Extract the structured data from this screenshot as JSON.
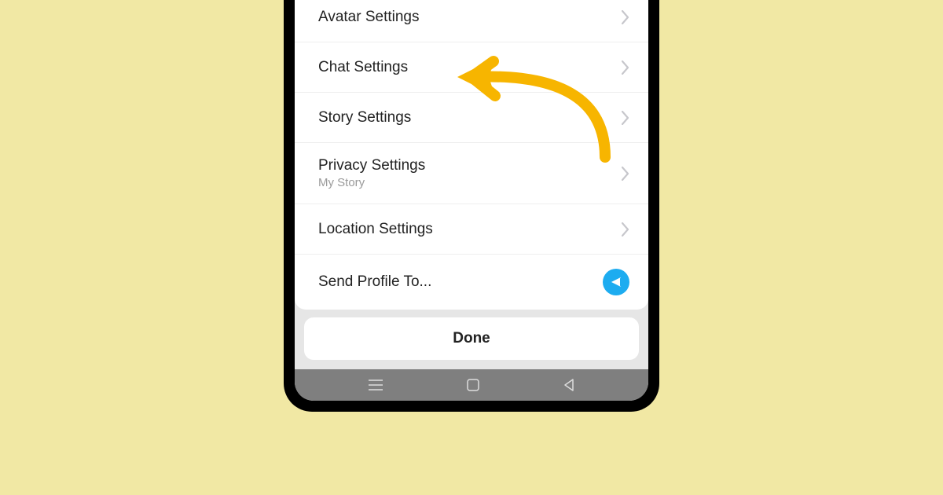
{
  "settings": {
    "items": [
      {
        "label": "Avatar Settings",
        "sub": "",
        "icon": "chevron"
      },
      {
        "label": "Chat Settings",
        "sub": "",
        "icon": "chevron"
      },
      {
        "label": "Story Settings",
        "sub": "",
        "icon": "chevron"
      },
      {
        "label": "Privacy Settings",
        "sub": "My Story",
        "icon": "chevron"
      },
      {
        "label": "Location Settings",
        "sub": "",
        "icon": "chevron"
      },
      {
        "label": "Send Profile To...",
        "sub": "",
        "icon": "send"
      }
    ]
  },
  "done": {
    "label": "Done"
  },
  "colors": {
    "accent_send": "#1dacf0",
    "annotation_arrow": "#f7b500"
  }
}
